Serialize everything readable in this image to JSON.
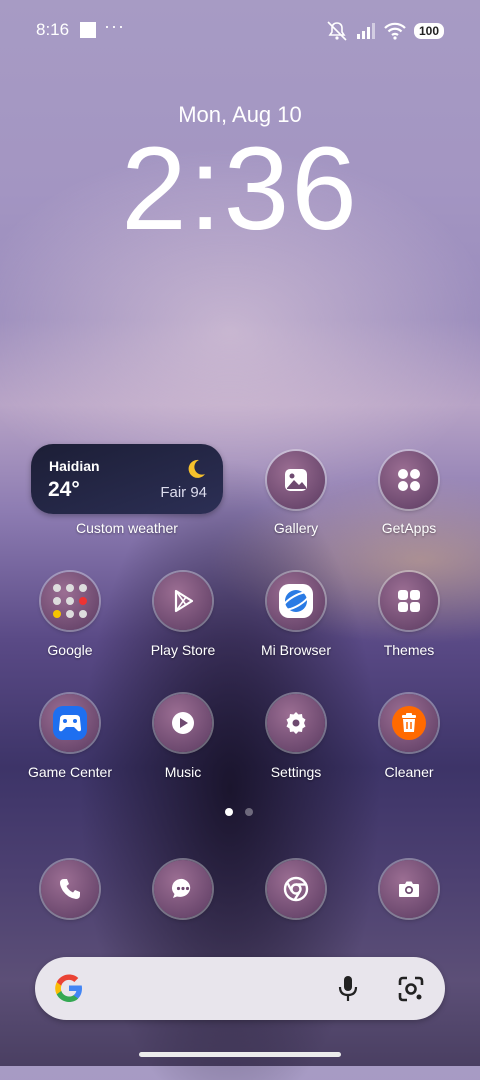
{
  "status_bar": {
    "time": "8:16",
    "more": "···",
    "battery": "100"
  },
  "lock": {
    "date": "Mon, Aug 10",
    "time": "2:36"
  },
  "weather_widget": {
    "city": "Haidian",
    "temp": "24°",
    "condition": "Fair 94",
    "label": "Custom weather"
  },
  "apps": {
    "gallery": "Gallery",
    "getapps": "GetApps",
    "google": "Google",
    "play_store": "Play Store",
    "mi_browser": "Mi Browser",
    "themes": "Themes",
    "game_center": "Game Center",
    "music": "Music",
    "settings": "Settings",
    "cleaner": "Cleaner"
  },
  "dock": [
    "phone-icon",
    "messages-icon",
    "chrome-icon",
    "camera-icon"
  ],
  "page_indicator": {
    "count": 2,
    "active": 1
  },
  "colors": {
    "widget_bg": "#1c1e36",
    "icon_bg": "#6e4a70",
    "cleaner": "#ff6a00",
    "browser": "#2a7be4",
    "game_center": "#1e6ff0"
  }
}
